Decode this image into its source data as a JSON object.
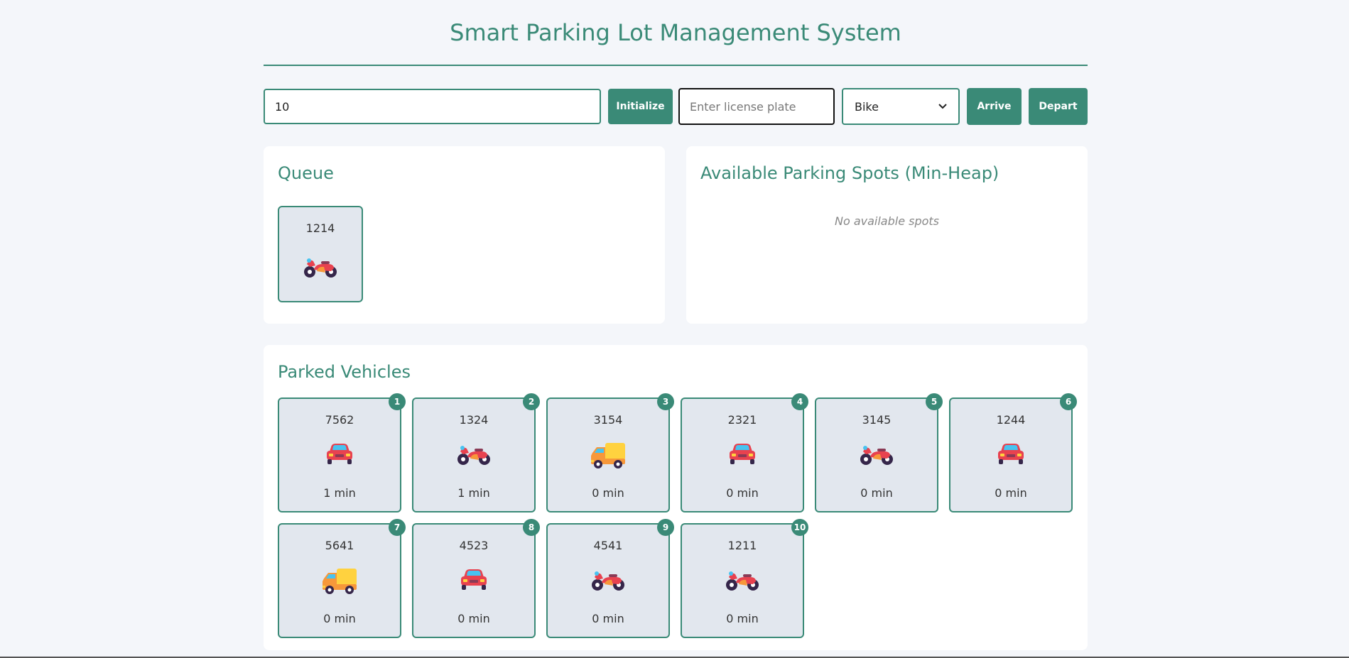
{
  "header": {
    "title": "Smart Parking Lot Management System"
  },
  "controls": {
    "capacity_value": "10",
    "initialize_label": "Initialize",
    "plate_placeholder": "Enter license plate",
    "type_selected": "Bike",
    "arrive_label": "Arrive",
    "depart_label": "Depart"
  },
  "queue": {
    "title": "Queue",
    "items": [
      {
        "plate": "1214",
        "type": "bike"
      }
    ]
  },
  "available": {
    "title": "Available Parking Spots (Min-Heap)",
    "empty_text": "No available spots"
  },
  "parked": {
    "title": "Parked Vehicles",
    "spots": [
      {
        "spot": "1",
        "plate": "7562",
        "type": "car",
        "time": "1 min"
      },
      {
        "spot": "2",
        "plate": "1324",
        "type": "bike",
        "time": "1 min"
      },
      {
        "spot": "3",
        "plate": "3154",
        "type": "truck",
        "time": "0 min"
      },
      {
        "spot": "4",
        "plate": "2321",
        "type": "car",
        "time": "0 min"
      },
      {
        "spot": "5",
        "plate": "3145",
        "type": "bike",
        "time": "0 min"
      },
      {
        "spot": "6",
        "plate": "1244",
        "type": "car",
        "time": "0 min"
      },
      {
        "spot": "7",
        "plate": "5641",
        "type": "truck",
        "time": "0 min"
      },
      {
        "spot": "8",
        "plate": "4523",
        "type": "car",
        "time": "0 min"
      },
      {
        "spot": "9",
        "plate": "4541",
        "type": "bike",
        "time": "0 min"
      },
      {
        "spot": "10",
        "plate": "1211",
        "type": "bike",
        "time": "0 min"
      }
    ]
  },
  "colors": {
    "accent": "#3a8a77",
    "card_bg": "#e2e7ee",
    "page_bg": "#f4f6fa"
  }
}
